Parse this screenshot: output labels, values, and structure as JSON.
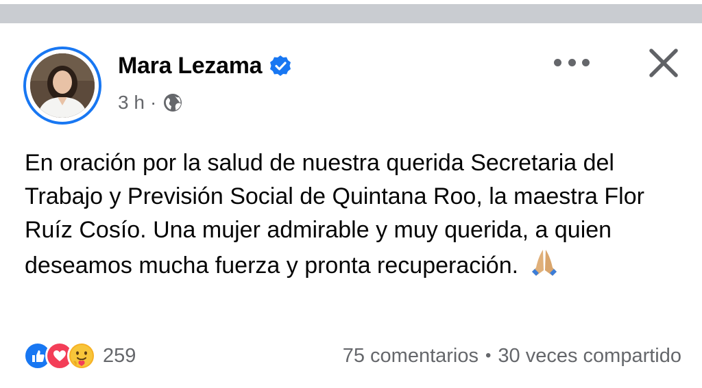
{
  "post": {
    "author_name": "Mara Lezama",
    "time": "3 h",
    "time_separator": "·",
    "text": "En oración por la salud de nuestra querida Secretaria del Trabajo y Previsión Social de Quintana Roo, la maestra Flor Ruíz Cosío. Una mujer admirable y muy querida, a quien deseamos mucha fuerza y pronta recuperación.",
    "emoji": "🙏"
  },
  "footer": {
    "reaction_count": "259",
    "comments": "75 comentarios",
    "separator": "•",
    "shares": "30 veces compartido"
  },
  "icons": {
    "verified": "verified-badge-icon",
    "privacy": "globe-icon",
    "more": "more-options-icon",
    "close": "close-icon",
    "reactions": [
      "like-reaction-icon",
      "love-reaction-icon",
      "care-reaction-icon"
    ]
  },
  "colors": {
    "accent": "#1877f2",
    "secondary_text": "#65676b",
    "love": "#f33e58",
    "care": "#f7b125",
    "top_strip": "#c9ccd1"
  }
}
